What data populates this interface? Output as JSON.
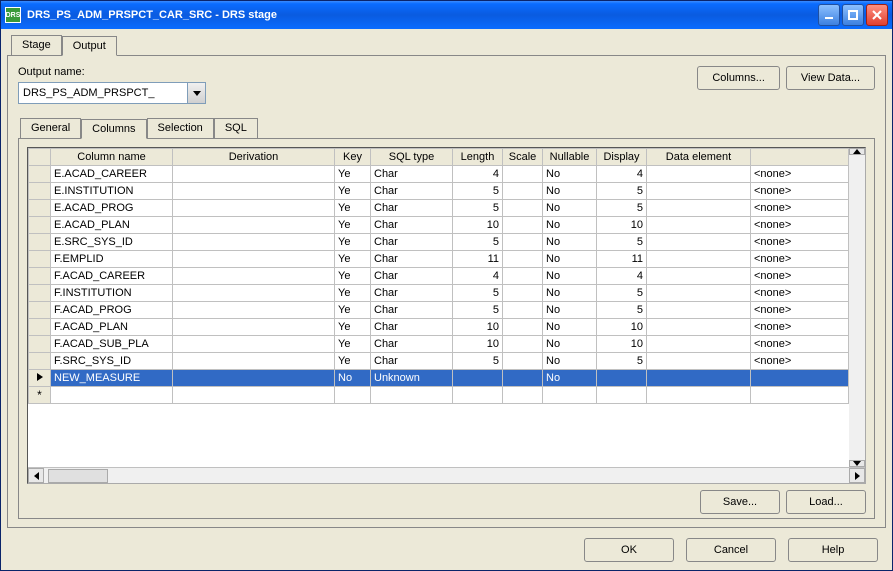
{
  "window": {
    "title": "DRS_PS_ADM_PRSPCT_CAR_SRC - DRS stage",
    "icon_label": "DRS"
  },
  "outer_tabs": [
    "Stage",
    "Output"
  ],
  "outer_tab_active": 1,
  "output_name_label": "Output name:",
  "output_name_value": "DRS_PS_ADM_PRSPCT_",
  "btn_columns": "Columns...",
  "btn_viewdata": "View Data...",
  "inner_tabs": [
    "General",
    "Columns",
    "Selection",
    "SQL"
  ],
  "inner_tab_active": 1,
  "grid": {
    "headers": [
      "Column name",
      "Derivation",
      "Key",
      "SQL type",
      "Length",
      "Scale",
      "Nullable",
      "Display",
      "Data element",
      ""
    ],
    "rows": [
      {
        "name": "E.ACAD_CAREER",
        "deriv": "",
        "key": "Ye",
        "sql": "Char",
        "len": "4",
        "scale": "",
        "null": "No",
        "disp": "4",
        "elem": "",
        "extra": "<none>"
      },
      {
        "name": "E.INSTITUTION",
        "deriv": "",
        "key": "Ye",
        "sql": "Char",
        "len": "5",
        "scale": "",
        "null": "No",
        "disp": "5",
        "elem": "",
        "extra": "<none>"
      },
      {
        "name": "E.ACAD_PROG",
        "deriv": "",
        "key": "Ye",
        "sql": "Char",
        "len": "5",
        "scale": "",
        "null": "No",
        "disp": "5",
        "elem": "",
        "extra": "<none>"
      },
      {
        "name": "E.ACAD_PLAN",
        "deriv": "",
        "key": "Ye",
        "sql": "Char",
        "len": "10",
        "scale": "",
        "null": "No",
        "disp": "10",
        "elem": "",
        "extra": "<none>"
      },
      {
        "name": "E.SRC_SYS_ID",
        "deriv": "",
        "key": "Ye",
        "sql": "Char",
        "len": "5",
        "scale": "",
        "null": "No",
        "disp": "5",
        "elem": "",
        "extra": "<none>"
      },
      {
        "name": "F.EMPLID",
        "deriv": "",
        "key": "Ye",
        "sql": "Char",
        "len": "11",
        "scale": "",
        "null": "No",
        "disp": "11",
        "elem": "",
        "extra": "<none>"
      },
      {
        "name": "F.ACAD_CAREER",
        "deriv": "",
        "key": "Ye",
        "sql": "Char",
        "len": "4",
        "scale": "",
        "null": "No",
        "disp": "4",
        "elem": "",
        "extra": "<none>"
      },
      {
        "name": "F.INSTITUTION",
        "deriv": "",
        "key": "Ye",
        "sql": "Char",
        "len": "5",
        "scale": "",
        "null": "No",
        "disp": "5",
        "elem": "",
        "extra": "<none>"
      },
      {
        "name": "F.ACAD_PROG",
        "deriv": "",
        "key": "Ye",
        "sql": "Char",
        "len": "5",
        "scale": "",
        "null": "No",
        "disp": "5",
        "elem": "",
        "extra": "<none>"
      },
      {
        "name": "F.ACAD_PLAN",
        "deriv": "",
        "key": "Ye",
        "sql": "Char",
        "len": "10",
        "scale": "",
        "null": "No",
        "disp": "10",
        "elem": "",
        "extra": "<none>"
      },
      {
        "name": "F.ACAD_SUB_PLA",
        "deriv": "",
        "key": "Ye",
        "sql": "Char",
        "len": "10",
        "scale": "",
        "null": "No",
        "disp": "10",
        "elem": "",
        "extra": "<none>"
      },
      {
        "name": "F.SRC_SYS_ID",
        "deriv": "",
        "key": "Ye",
        "sql": "Char",
        "len": "5",
        "scale": "",
        "null": "No",
        "disp": "5",
        "elem": "",
        "extra": "<none>"
      },
      {
        "name": "NEW_MEASURE",
        "deriv": "",
        "key": "No",
        "sql": "Unknown",
        "len": "",
        "scale": "",
        "null": "No",
        "disp": "",
        "elem": "",
        "extra": "",
        "selected": true,
        "marker": "current"
      }
    ],
    "new_row_marker": "*"
  },
  "btn_save": "Save...",
  "btn_load": "Load...",
  "btn_ok": "OK",
  "btn_cancel": "Cancel",
  "btn_help": "Help"
}
